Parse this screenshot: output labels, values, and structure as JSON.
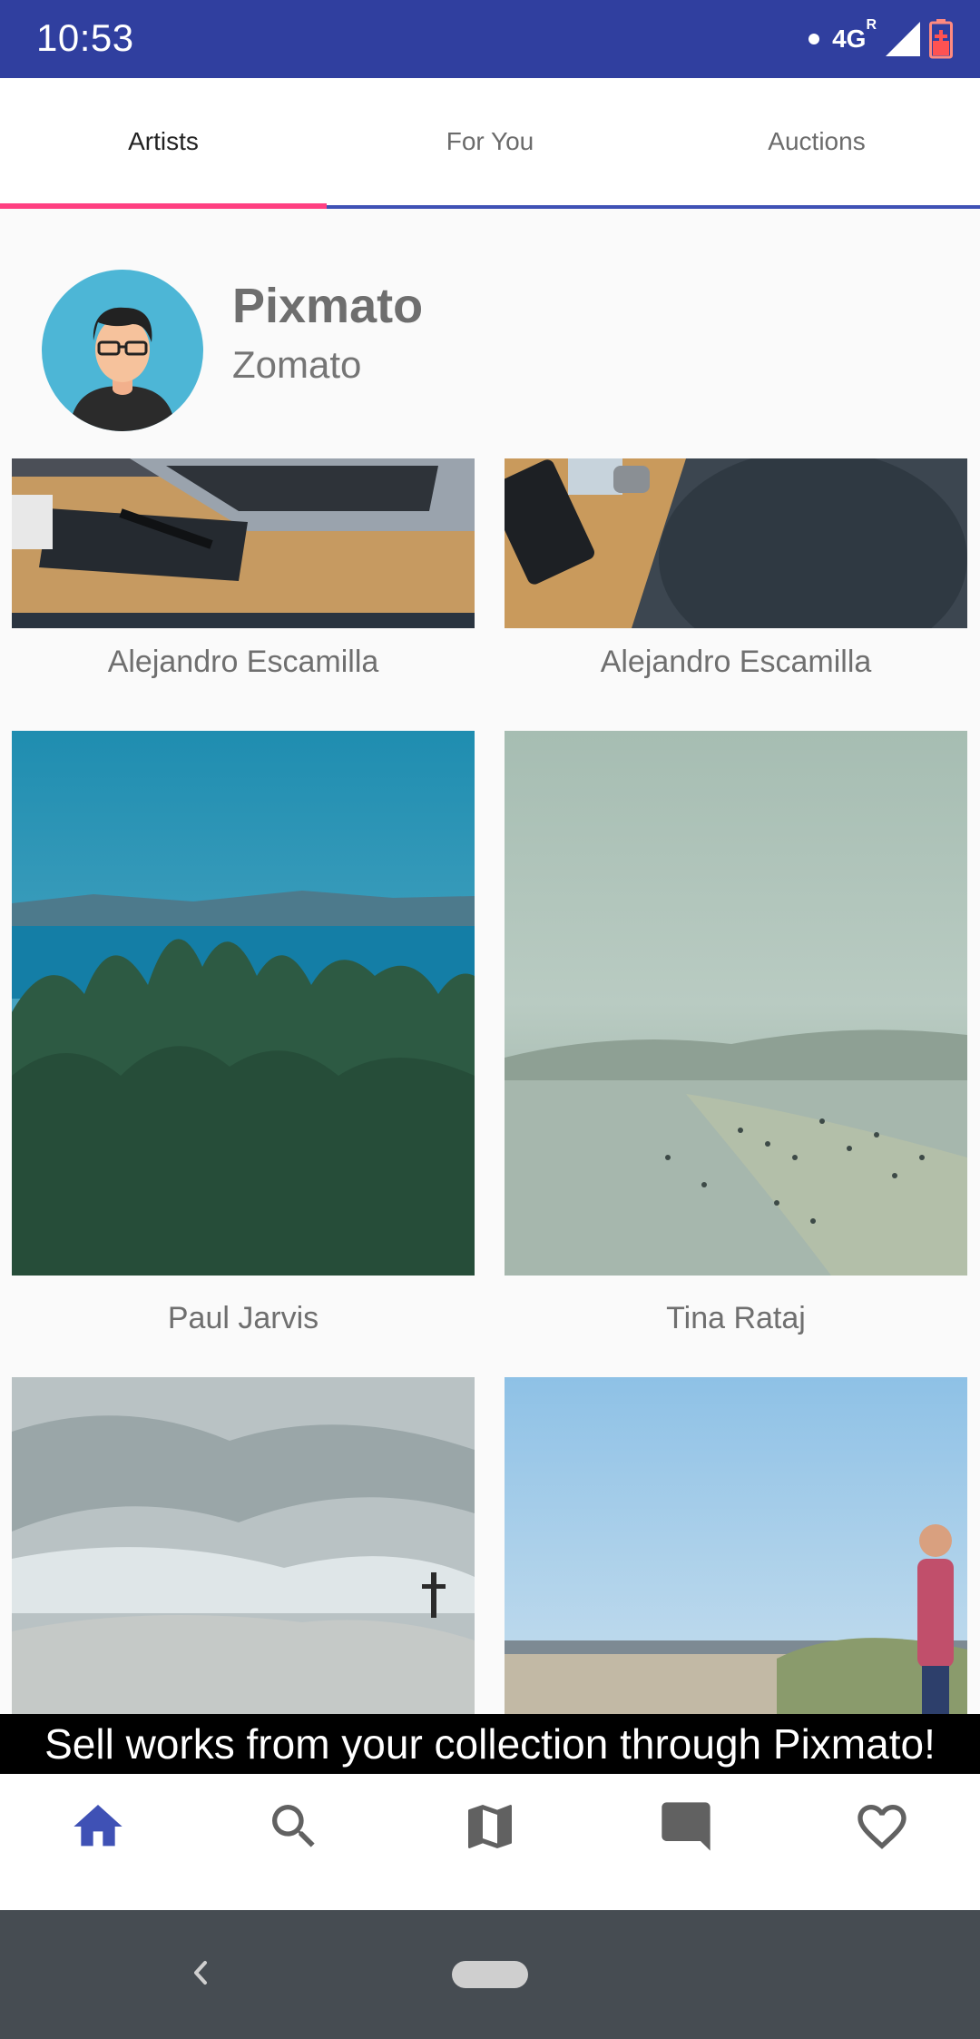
{
  "status_bar": {
    "time": "10:53",
    "network": "4G",
    "network_sup": "R"
  },
  "tabs": [
    {
      "label": "Artists",
      "active": true
    },
    {
      "label": "For You",
      "active": false
    },
    {
      "label": "Auctions",
      "active": false
    }
  ],
  "profile": {
    "name": "Pixmato",
    "subtitle": "Zomato"
  },
  "grid": {
    "items": [
      {
        "artist": "Alejandro Escamilla",
        "image": "laptop-desk-photo"
      },
      {
        "artist": "Alejandro Escamilla",
        "image": "desk-phone-photo"
      },
      {
        "artist": "Paul Jarvis",
        "image": "forest-lake-photo"
      },
      {
        "artist": "Tina Rataj",
        "image": "misty-beach-photo"
      },
      {
        "artist": "",
        "image": "cloudy-hill-cross-photo"
      },
      {
        "artist": "",
        "image": "beach-person-photo"
      }
    ]
  },
  "banner": {
    "text": "Sell works from your collection through Pixmato!"
  },
  "bottom_nav": {
    "items": [
      "home-icon",
      "search-icon",
      "map-icon",
      "chat-icon",
      "heart-icon"
    ],
    "active": "home-icon",
    "accent_color": "#3f51b5",
    "inactive_color": "#616161"
  },
  "colors": {
    "status_bar": "#303f9f",
    "tab_indicator": "#ff4081",
    "tab_baseline": "#3f51b5"
  }
}
